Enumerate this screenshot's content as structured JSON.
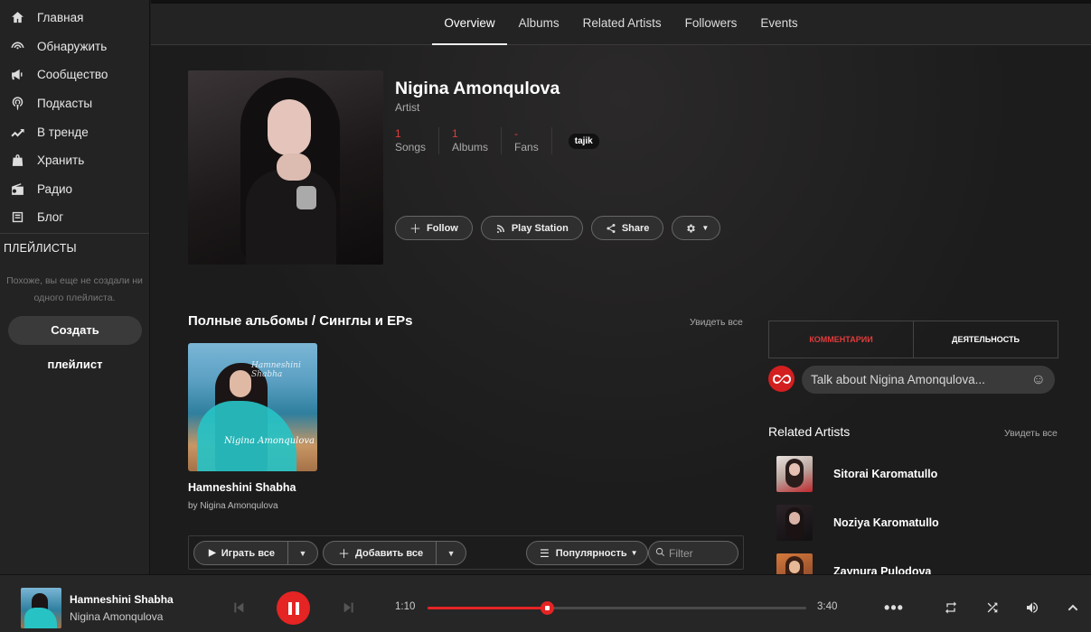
{
  "sidebar": {
    "items": [
      {
        "label": "Главная",
        "icon": "home-icon"
      },
      {
        "label": "Обнаружить",
        "icon": "discover-icon"
      },
      {
        "label": "Сообщество",
        "icon": "megaphone-icon"
      },
      {
        "label": "Подкасты",
        "icon": "podcast-icon"
      },
      {
        "label": "В тренде",
        "icon": "trending-icon"
      },
      {
        "label": "Хранить",
        "icon": "store-icon"
      },
      {
        "label": "Радио",
        "icon": "radio-icon"
      },
      {
        "label": "Блог",
        "icon": "blog-icon"
      }
    ],
    "playlists_title": "ПЛЕЙЛИСТЫ",
    "playlists_empty": "Похоже, вы еще не создали ни одного плейлиста.",
    "create_line1": "Создать",
    "create_line2": "плейлист"
  },
  "tabs": [
    {
      "label": "Overview",
      "active": true
    },
    {
      "label": "Albums",
      "active": false
    },
    {
      "label": "Related Artists",
      "active": false
    },
    {
      "label": "Followers",
      "active": false
    },
    {
      "label": "Events",
      "active": false
    }
  ],
  "artist": {
    "name": "Nigina Amonqulova",
    "type": "Artist",
    "stats": [
      {
        "num": "1",
        "cap": "Songs"
      },
      {
        "num": "1",
        "cap": "Albums"
      },
      {
        "num": "-",
        "cap": "Fans"
      }
    ],
    "tag": "tajik"
  },
  "actions": {
    "follow": "Follow",
    "play_station": "Play Station",
    "share": "Share"
  },
  "albums_section": {
    "title": "Полные альбомы / Синглы и EPs",
    "see_all": "Увидеть все",
    "album": {
      "title": "Hamneshini Shabha",
      "by": "by Nigina Amonqulova",
      "cover_text": "Nigina Amonqulova",
      "cover_text2": "Hamneshini Shabha"
    }
  },
  "toolbar": {
    "play_all": "Играть все",
    "add_all": "Добавить все",
    "sort": "Популярность",
    "filter_placeholder": "Filter"
  },
  "comments": {
    "tab_comments": "КОММЕНТАРИИ",
    "tab_activity": "ДЕЯТЕЛЬНОСТЬ",
    "placeholder": "Talk about Nigina Amonqulova..."
  },
  "related": {
    "title": "Related Artists",
    "see_all": "Увидеть все",
    "artists": [
      {
        "name": "Sitorai Karomatullo"
      },
      {
        "name": "Noziya Karomatullo"
      },
      {
        "name": "Zaynura Pulodova"
      }
    ]
  },
  "player": {
    "title": "Hamneshini Shabha",
    "artist": "Nigina Amonqulova",
    "current_time": "1:10",
    "total_time": "3:40",
    "progress": 0.315
  },
  "colors": {
    "accent": "#e52424",
    "stat_number": "#e03c3c"
  }
}
